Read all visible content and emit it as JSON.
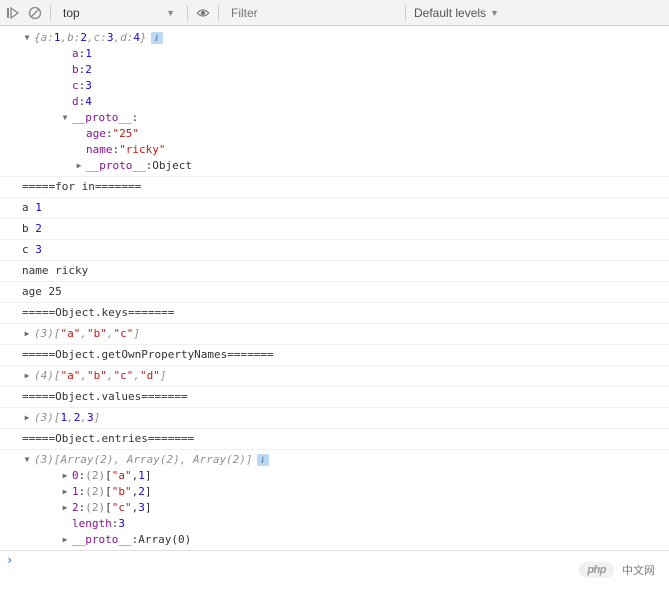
{
  "toolbar": {
    "context": "top",
    "filter_placeholder": "Filter",
    "levels": "Default levels"
  },
  "obj_preview": {
    "open": "{",
    "a_key": "a",
    "a_val": "1",
    "b_key": "b",
    "b_val": "2",
    "c_key": "c",
    "c_val": "3",
    "d_key": "d",
    "d_val": "4",
    "close": "}"
  },
  "obj_props": {
    "a": {
      "key": "a",
      "val": "1"
    },
    "b": {
      "key": "b",
      "val": "2"
    },
    "c": {
      "key": "c",
      "val": "3"
    },
    "d": {
      "key": "d",
      "val": "4"
    },
    "proto_key": "__proto__",
    "age": {
      "key": "age",
      "val": "\"25\""
    },
    "name": {
      "key": "name",
      "val": "\"ricky\""
    },
    "proto_inner": {
      "key": "__proto__",
      "val": "Object"
    }
  },
  "logs": {
    "forin_header": "=====for in=======",
    "a": "a 1",
    "b": "b 2",
    "c": "c 3",
    "name_ricky": "name ricky",
    "age_25": "age 25",
    "keys_header": "=====Object.keys=======",
    "gopn_header": "=====Object.getOwnPropertyNames=======",
    "values_header": "=====Object.values=======",
    "entries_header": "=====Object.entries======="
  },
  "keys_arr": {
    "len": "(3)",
    "b_open": "[",
    "v0": "\"a\"",
    "v1": "\"b\"",
    "v2": "\"c\"",
    "b_close": "]"
  },
  "gopn_arr": {
    "len": "(4)",
    "b_open": "[",
    "v0": "\"a\"",
    "v1": "\"b\"",
    "v2": "\"c\"",
    "v3": "\"d\"",
    "b_close": "]"
  },
  "values_arr": {
    "len": "(3)",
    "b_open": "[",
    "v0": "1",
    "v1": "2",
    "v2": "3",
    "b_close": "]"
  },
  "entries": {
    "len": "(3)",
    "preview": "[Array(2), Array(2), Array(2)]",
    "rows": [
      {
        "idx": "0",
        "len": "(2)",
        "open": "[",
        "v0": "\"a\"",
        "v1": "1",
        "close": "]"
      },
      {
        "idx": "1",
        "len": "(2)",
        "open": "[",
        "v0": "\"b\"",
        "v1": "2",
        "close": "]"
      },
      {
        "idx": "2",
        "len": "(2)",
        "open": "[",
        "v0": "\"c\"",
        "v1": "3",
        "close": "]"
      }
    ],
    "length_key": "length",
    "length_val": "3",
    "proto_key": "__proto__",
    "proto_val": "Array(0)"
  },
  "watermark": {
    "badge": "php",
    "text": "中文网"
  }
}
